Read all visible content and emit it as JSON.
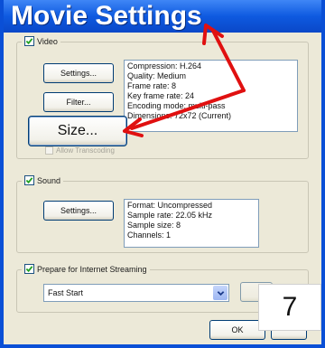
{
  "window": {
    "title": "Movie Settings"
  },
  "video": {
    "label": "Video",
    "checked": true,
    "settings_button": "Settings...",
    "filter_button": "Filter...",
    "size_button": "Size...",
    "info_lines": [
      "Compression: H.264",
      "Quality: Medium",
      "Frame rate: 8",
      "Key frame rate: 24",
      "Encoding mode: multi-pass",
      "Dimensions: 72x72 (Current)"
    ],
    "transcoding_label": "Allow Transcoding"
  },
  "sound": {
    "label": "Sound",
    "checked": true,
    "settings_button": "Settings...",
    "info_lines": [
      "Format: Uncompressed",
      "Sample rate: 22.05 kHz",
      "Sample size: 8",
      "Channels: 1"
    ]
  },
  "streaming": {
    "label": "Prepare for Internet Streaming",
    "checked": true,
    "selected_option": "Fast Start"
  },
  "footer": {
    "ok_button": "OK",
    "step_number": "7"
  },
  "colors": {
    "titlebar": "#0e5ae0",
    "annotation_arrow": "#e01010",
    "dialog_bg": "#ece9d8"
  }
}
